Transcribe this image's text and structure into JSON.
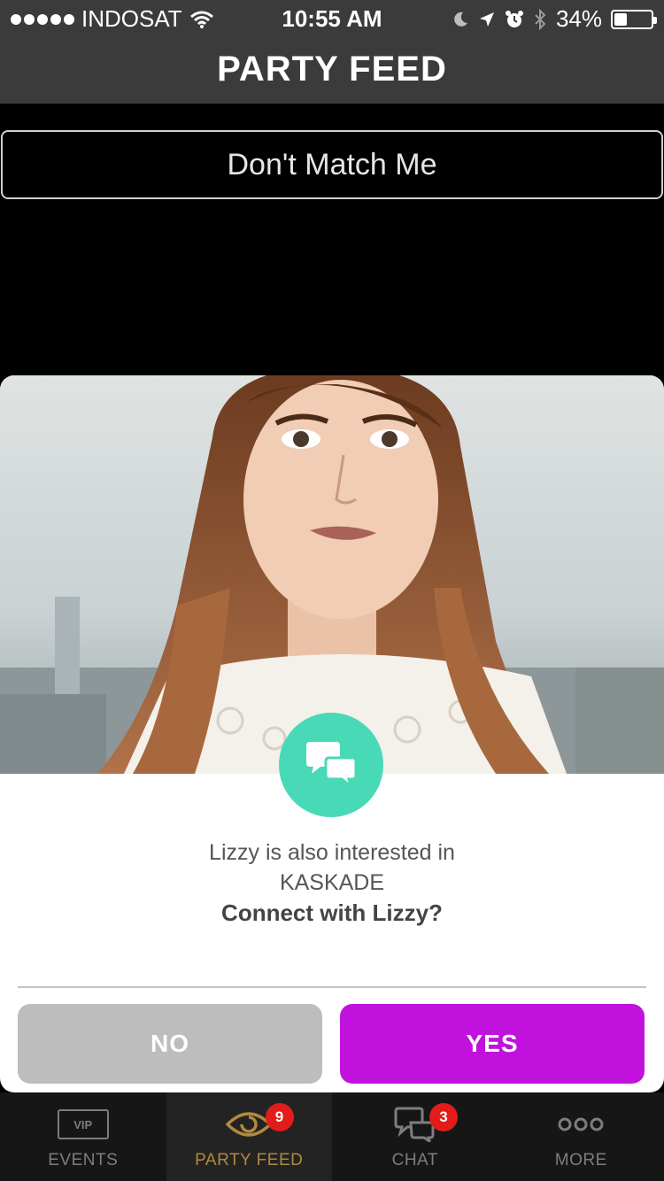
{
  "status_bar": {
    "carrier": "INDOSAT",
    "time": "10:55 AM",
    "battery_percent": "34%",
    "battery_level": 0.34,
    "icons": [
      "signal-dots-icon",
      "wifi-icon",
      "moon-icon",
      "location-arrow-icon",
      "alarm-icon",
      "bluetooth-icon",
      "battery-icon"
    ]
  },
  "header": {
    "title": "PARTY FEED"
  },
  "dont_match": {
    "label": "Don't Match Me"
  },
  "card": {
    "photo": "profile-photo",
    "chat_icon": "chat-bubbles-icon",
    "interest_line1": "Lizzy is also interested in",
    "interest_line2": "KASKADE",
    "connect_prompt": "Connect with Lizzy?",
    "no_label": "NO",
    "yes_label": "YES"
  },
  "tab_bar": {
    "tabs": [
      {
        "label": "EVENTS",
        "icon": "vip-icon",
        "icon_text": "VIP"
      },
      {
        "label": "PARTY FEED",
        "icon": "eye-icon",
        "badge": "9",
        "active": true
      },
      {
        "label": "CHAT",
        "icon": "chat-icon",
        "badge": "3"
      },
      {
        "label": "MORE",
        "icon": "more-icon"
      }
    ]
  },
  "colors": {
    "header_bg": "#3b3b3b",
    "accent_teal": "#48d9b7",
    "yes_purple": "#c012dc",
    "no_grey": "#bdbdbd",
    "active_tab_gold": "#b08a3e",
    "badge_red": "#e21b1b"
  }
}
